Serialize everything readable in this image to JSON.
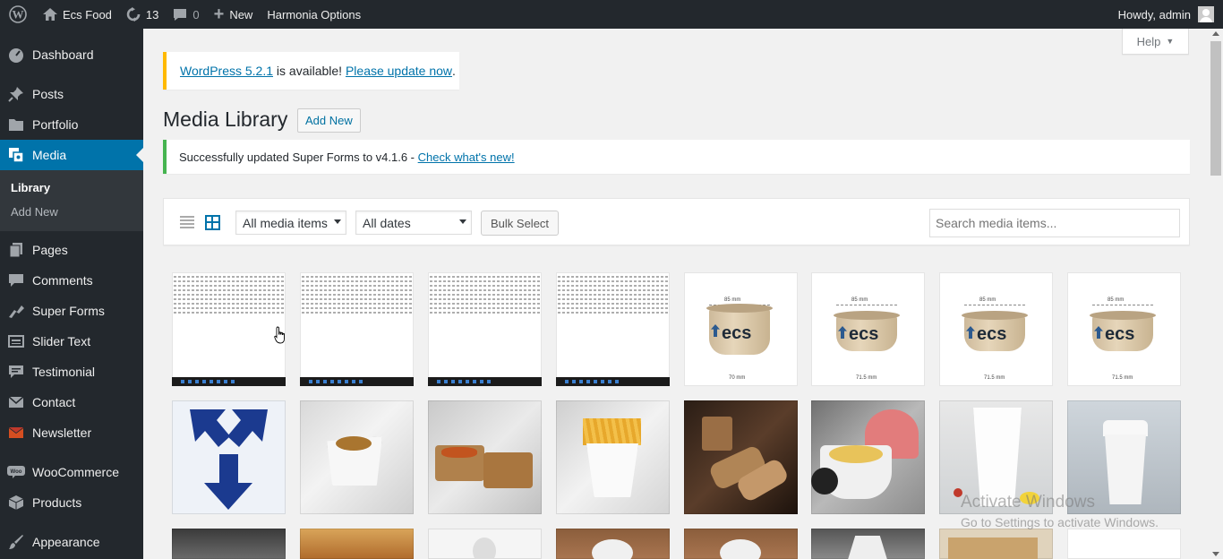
{
  "adminbar": {
    "site_name": "Ecs Food",
    "updates_count": "13",
    "comments_count": "0",
    "new_label": "New",
    "options_label": "Harmonia Options",
    "greeting": "Howdy, admin"
  },
  "sidebar": {
    "items": [
      {
        "label": "Dashboard",
        "icon": "dashboard-icon"
      },
      {
        "label": "Posts",
        "icon": "pin-icon"
      },
      {
        "label": "Portfolio",
        "icon": "folder-icon"
      },
      {
        "label": "Media",
        "icon": "media-icon"
      },
      {
        "label": "Pages",
        "icon": "page-icon"
      },
      {
        "label": "Comments",
        "icon": "comment-icon"
      },
      {
        "label": "Super Forms",
        "icon": "puzzle-icon"
      },
      {
        "label": "Slider Text",
        "icon": "slider-icon"
      },
      {
        "label": "Testimonial",
        "icon": "speech-icon"
      },
      {
        "label": "Contact",
        "icon": "mail-icon"
      },
      {
        "label": "Newsletter",
        "icon": "newsletter-icon"
      },
      {
        "label": "WooCommerce",
        "icon": "woo-icon"
      },
      {
        "label": "Products",
        "icon": "box-icon"
      },
      {
        "label": "Appearance",
        "icon": "brush-icon"
      }
    ],
    "submenu": [
      "Library",
      "Add New"
    ]
  },
  "help_label": "Help",
  "update_notice": {
    "link1": "WordPress 5.2.1",
    "middle": " is available! ",
    "link2": "Please update now",
    "end": "."
  },
  "page_title": "Media Library",
  "add_new_label": "Add New",
  "success_notice": {
    "text": "Successfully updated Super Forms to v4.1.6 - ",
    "link": "Check what's new!"
  },
  "toolbar": {
    "filter_type": "All media items",
    "filter_date": "All dates",
    "bulk_label": "Bulk Select",
    "search_placeholder": "Search media items..."
  },
  "cup_dims": {
    "top": "85 mm",
    "bottom1": "70 mm",
    "bottom2": "71.5 mm",
    "cup_brand": "ecs"
  },
  "watermark": {
    "line1": "Activate Windows",
    "line2": "Go to Settings to activate Windows."
  }
}
